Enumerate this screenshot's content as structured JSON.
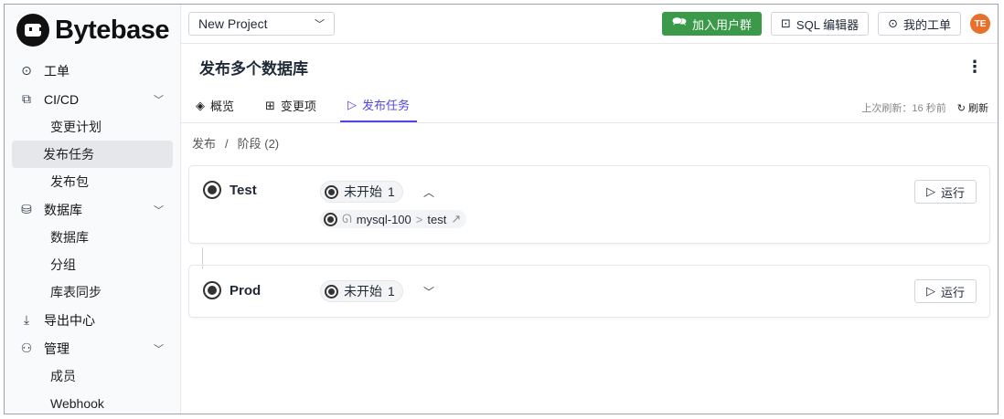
{
  "brand": "Bytebase",
  "sidebar": {
    "items": [
      {
        "label": "工单",
        "icon": "circle-dot-icon"
      },
      {
        "label": "CI/CD",
        "icon": "workflow-icon",
        "children": [
          "变更计划",
          "发布任务",
          "发布包"
        ]
      },
      {
        "label": "数据库",
        "icon": "database-icon",
        "children": [
          "数据库",
          "分组",
          "库表同步"
        ]
      },
      {
        "label": "导出中心",
        "icon": "download-icon"
      },
      {
        "label": "管理",
        "icon": "users-icon",
        "children": [
          "成员",
          "Webhook"
        ]
      }
    ]
  },
  "topbar": {
    "project": "New Project",
    "join_group": "加入用户群",
    "sql_editor": "SQL 编辑器",
    "my_issues": "我的工单",
    "avatar": "TE"
  },
  "page": {
    "title": "发布多个数据库"
  },
  "tabs": [
    {
      "label": "概览"
    },
    {
      "label": "变更项"
    },
    {
      "label": "发布任务"
    }
  ],
  "refresh": {
    "last": "上次刷新：16 秒前",
    "label": "刷新"
  },
  "breadcrumb": [
    "发布",
    "/",
    "阶段 (2)"
  ],
  "stages": [
    {
      "name": "Test",
      "status": "未开始",
      "count": "1",
      "run": "运行",
      "task": {
        "instance": "mysql-100",
        "sep": ">",
        "db": "test"
      }
    },
    {
      "name": "Prod",
      "status": "未开始",
      "count": "1",
      "run": "运行"
    }
  ]
}
